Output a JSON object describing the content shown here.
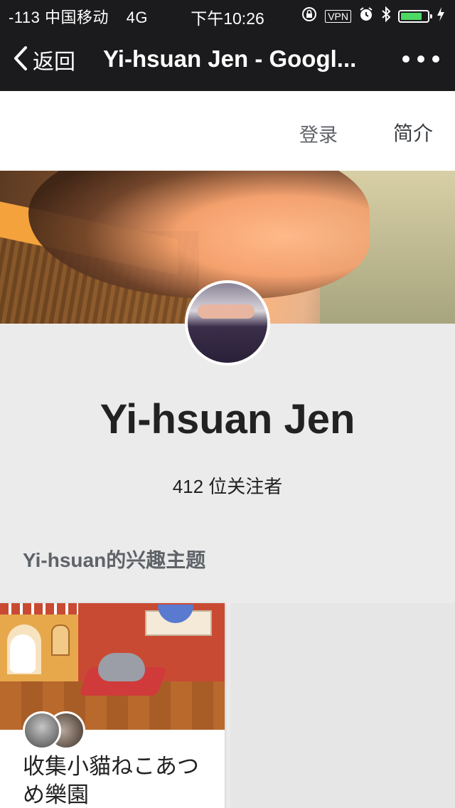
{
  "status_bar": {
    "signal": "-113 中国移动",
    "network": "4G",
    "time": "下午10:26",
    "vpn": "VPN",
    "battery_level": 0.8,
    "icons": [
      "orientation-lock-icon",
      "alarm-icon",
      "bluetooth-icon",
      "battery-icon",
      "charging-icon"
    ]
  },
  "nav": {
    "back_label": "返回",
    "title": "Yi-hsuan Jen - Googl...",
    "more_icon": "more-dots-icon"
  },
  "header": {
    "login_label": "登录",
    "about_label": "简介"
  },
  "profile": {
    "name": "Yi-hsuan Jen",
    "followers": "412 位关注者"
  },
  "collections": {
    "section_title": "Yi-hsuan的兴趣主题",
    "items": [
      {
        "title": "收集小貓ねこあつめ樂園"
      }
    ]
  },
  "colors": {
    "bar_background": "#1b1b1d",
    "page_background": "#ebebeb",
    "battery_green": "#4cd964"
  }
}
